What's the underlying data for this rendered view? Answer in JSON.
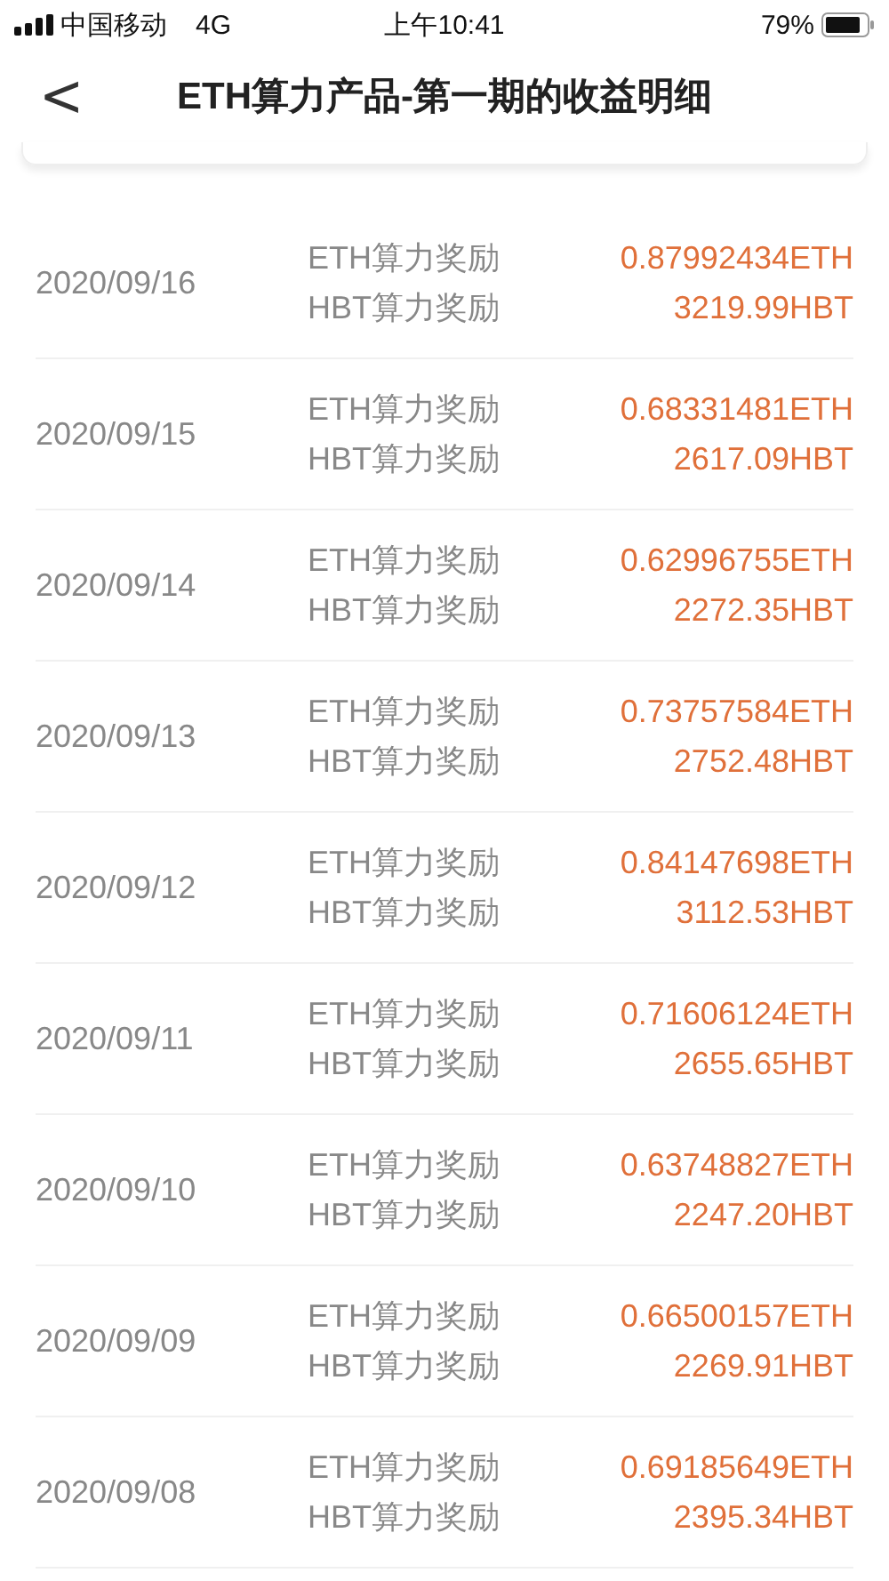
{
  "status_bar": {
    "carrier": "中国移动",
    "network": "4G",
    "time": "上午10:41",
    "battery": "79%"
  },
  "nav": {
    "back": "<",
    "title": "ETH算力产品-第一期的收益明细"
  },
  "rows": [
    {
      "date": "2020/09/16",
      "items": [
        {
          "label": "ETH算力奖励",
          "value": "0.87992434ETH"
        },
        {
          "label": "HBT算力奖励",
          "value": "3219.99HBT"
        }
      ]
    },
    {
      "date": "2020/09/15",
      "items": [
        {
          "label": "ETH算力奖励",
          "value": "0.68331481ETH"
        },
        {
          "label": "HBT算力奖励",
          "value": "2617.09HBT"
        }
      ]
    },
    {
      "date": "2020/09/14",
      "items": [
        {
          "label": "ETH算力奖励",
          "value": "0.62996755ETH"
        },
        {
          "label": "HBT算力奖励",
          "value": "2272.35HBT"
        }
      ]
    },
    {
      "date": "2020/09/13",
      "items": [
        {
          "label": "ETH算力奖励",
          "value": "0.73757584ETH"
        },
        {
          "label": "HBT算力奖励",
          "value": "2752.48HBT"
        }
      ]
    },
    {
      "date": "2020/09/12",
      "items": [
        {
          "label": "ETH算力奖励",
          "value": "0.84147698ETH"
        },
        {
          "label": "HBT算力奖励",
          "value": "3112.53HBT"
        }
      ]
    },
    {
      "date": "2020/09/11",
      "items": [
        {
          "label": "ETH算力奖励",
          "value": "0.71606124ETH"
        },
        {
          "label": "HBT算力奖励",
          "value": "2655.65HBT"
        }
      ]
    },
    {
      "date": "2020/09/10",
      "items": [
        {
          "label": "ETH算力奖励",
          "value": "0.63748827ETH"
        },
        {
          "label": "HBT算力奖励",
          "value": "2247.20HBT"
        }
      ]
    },
    {
      "date": "2020/09/09",
      "items": [
        {
          "label": "ETH算力奖励",
          "value": "0.66500157ETH"
        },
        {
          "label": "HBT算力奖励",
          "value": "2269.91HBT"
        }
      ]
    },
    {
      "date": "2020/09/08",
      "items": [
        {
          "label": "ETH算力奖励",
          "value": "0.69185649ETH"
        },
        {
          "label": "HBT算力奖励",
          "value": "2395.34HBT"
        }
      ]
    }
  ]
}
